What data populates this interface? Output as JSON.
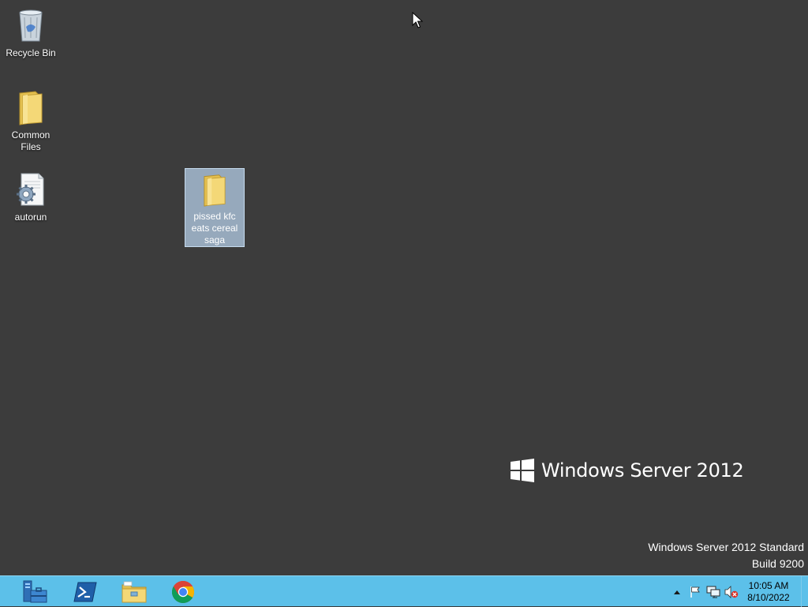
{
  "desktop": {
    "icons": [
      {
        "label": "Recycle Bin",
        "icon": "recycle-bin-icon"
      },
      {
        "label": "Common Files",
        "icon": "folder-icon"
      },
      {
        "label": "autorun",
        "icon": "settings-file-icon"
      },
      {
        "label": "pissed kfc eats cereal saga",
        "icon": "folder-icon",
        "selected": true
      }
    ],
    "branding": "Windows Server 2012",
    "watermark": {
      "line1": "Windows Server 2012 Standard",
      "line2": "Build 9200"
    }
  },
  "taskbar": {
    "pinned": [
      {
        "name": "server-manager",
        "icon": "server-manager-icon"
      },
      {
        "name": "powershell",
        "icon": "powershell-icon"
      },
      {
        "name": "file-explorer",
        "icon": "file-explorer-icon"
      },
      {
        "name": "chrome",
        "icon": "chrome-icon"
      }
    ],
    "tray": {
      "icons": [
        "show-hidden-icons-arrow",
        "action-center-flag-icon",
        "network-icon",
        "volume-muted-icon"
      ],
      "time": "10:05 AM",
      "date": "8/10/2022"
    }
  },
  "colors": {
    "desktop_bg": "#3c3c3c",
    "taskbar_bg": "#5cc0e9",
    "selection": "#b0c8e0"
  }
}
